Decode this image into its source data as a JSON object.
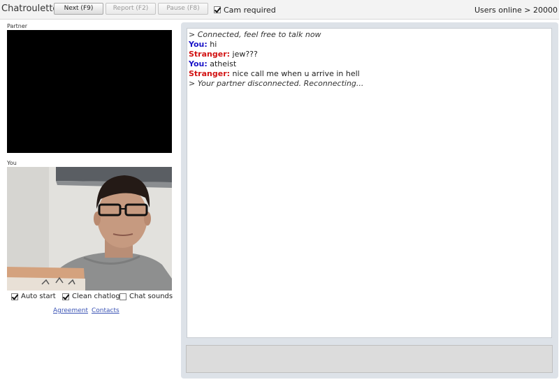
{
  "app": {
    "title": "Chatroulette"
  },
  "toolbar": {
    "next_label": "Next (F9)",
    "report_label": "Report (F2)",
    "pause_label": "Pause (F8)",
    "cam_required_label": "Cam required",
    "cam_required_checked": true
  },
  "status": {
    "users_online": "Users online > 20000"
  },
  "videos": {
    "partner_label": "Partner",
    "you_label": "You"
  },
  "options": {
    "auto_start": {
      "label": "Auto start",
      "checked": true
    },
    "clean_chatlog": {
      "label": "Clean chatlog",
      "checked": true
    },
    "chat_sounds": {
      "label": "Chat sounds",
      "checked": false
    }
  },
  "links": {
    "agreement": "Agreement",
    "contacts": "Contacts"
  },
  "chat": {
    "messages": [
      {
        "type": "system",
        "text": "> Connected, feel free to talk now"
      },
      {
        "type": "you",
        "speaker": "You:",
        "text": " hi"
      },
      {
        "type": "stranger",
        "speaker": "Stranger:",
        "text": " jew???"
      },
      {
        "type": "you",
        "speaker": "You:",
        "text": " atheist"
      },
      {
        "type": "stranger",
        "speaker": "Stranger:",
        "text": " nice call me when u arrive in hell"
      },
      {
        "type": "system",
        "text": "> Your partner disconnected. Reconnecting..."
      }
    ]
  },
  "colors": {
    "you_name": "#1a14c8",
    "stranger_name": "#d21414",
    "chat_panel_bg": "#dde2e8"
  }
}
